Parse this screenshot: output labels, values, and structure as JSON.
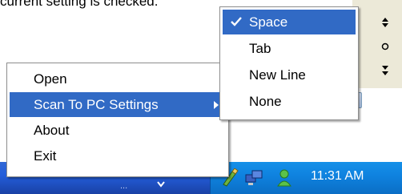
{
  "caption": "current setting is checked.",
  "side_controls": [
    "↕",
    "○",
    "↕"
  ],
  "context_menu": {
    "items": [
      {
        "label": "Open"
      },
      {
        "label": "Scan To PC Settings"
      },
      {
        "label": "About"
      },
      {
        "label": "Exit"
      }
    ]
  },
  "submenu": {
    "items": [
      {
        "label": "Space",
        "checked": true
      },
      {
        "label": "Tab"
      },
      {
        "label": "New Line"
      },
      {
        "label": "None"
      }
    ]
  },
  "taskbar": {
    "clock": "11:31 AM",
    "faded_text": "...",
    "highlight_color": "#316ac5",
    "taskbar_color": "#245edb",
    "tray_color": "#0f83e0"
  }
}
